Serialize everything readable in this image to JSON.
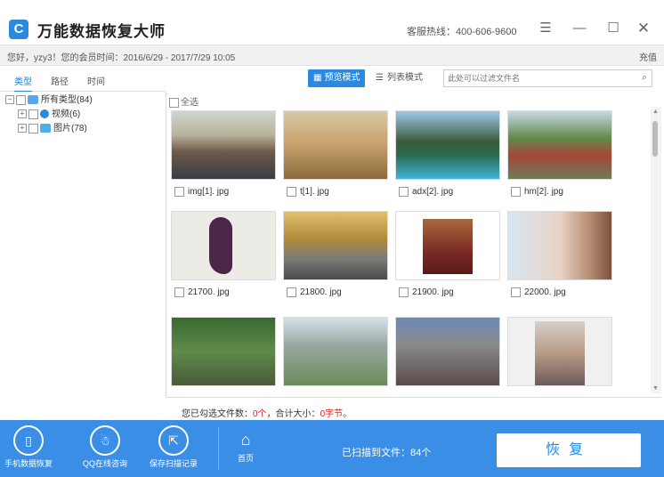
{
  "app": {
    "title": "万能数据恢复大师",
    "hotline": "客服热线：400-606-9600",
    "logo_glyph": "C"
  },
  "infobar": {
    "greeting": "您好，yzy3！您的会员时间：2016/6/29 - 2017/7/29 10:05",
    "recharge": "充值"
  },
  "tabs": [
    {
      "label": "类型"
    },
    {
      "label": "路径"
    },
    {
      "label": "时间"
    }
  ],
  "toolbar": {
    "preview_label": "预览模式",
    "list_label": "列表模式",
    "search_placeholder": "此处可以过滤文件名"
  },
  "tree": [
    {
      "label": "所有类型(84)",
      "icon": "computer-icon"
    },
    {
      "label": "视频(6)",
      "icon": "video-icon"
    },
    {
      "label": "图片(78)",
      "icon": "image-icon"
    }
  ],
  "grid": {
    "select_all": "全选",
    "items": [
      {
        "name": "img[1]. jpg"
      },
      {
        "name": "t[1]. jpg"
      },
      {
        "name": "adx[2]. jpg"
      },
      {
        "name": "hm[2]. jpg"
      },
      {
        "name": "21700. jpg"
      },
      {
        "name": "21800. jpg"
      },
      {
        "name": "21900. jpg"
      },
      {
        "name": "22000. jpg"
      },
      {
        "name": ""
      },
      {
        "name": ""
      },
      {
        "name": ""
      },
      {
        "name": ""
      }
    ]
  },
  "status": {
    "prefix": "您已勾选文件数：",
    "count": "0个",
    "mid": "，合计大小：",
    "size": "0字节",
    "suffix": "。"
  },
  "bottombar": {
    "items": [
      {
        "label": "手机数据恢复"
      },
      {
        "label": "QQ在线咨询"
      },
      {
        "label": "保存扫描记录"
      },
      {
        "label": "首页"
      }
    ],
    "scanned": "已扫描到文件：84个",
    "recover_label": "恢复"
  },
  "colors": {
    "accent": "#2a8ae0",
    "bottom_bar": "#3a8ee6",
    "status_red": "#e02020"
  }
}
